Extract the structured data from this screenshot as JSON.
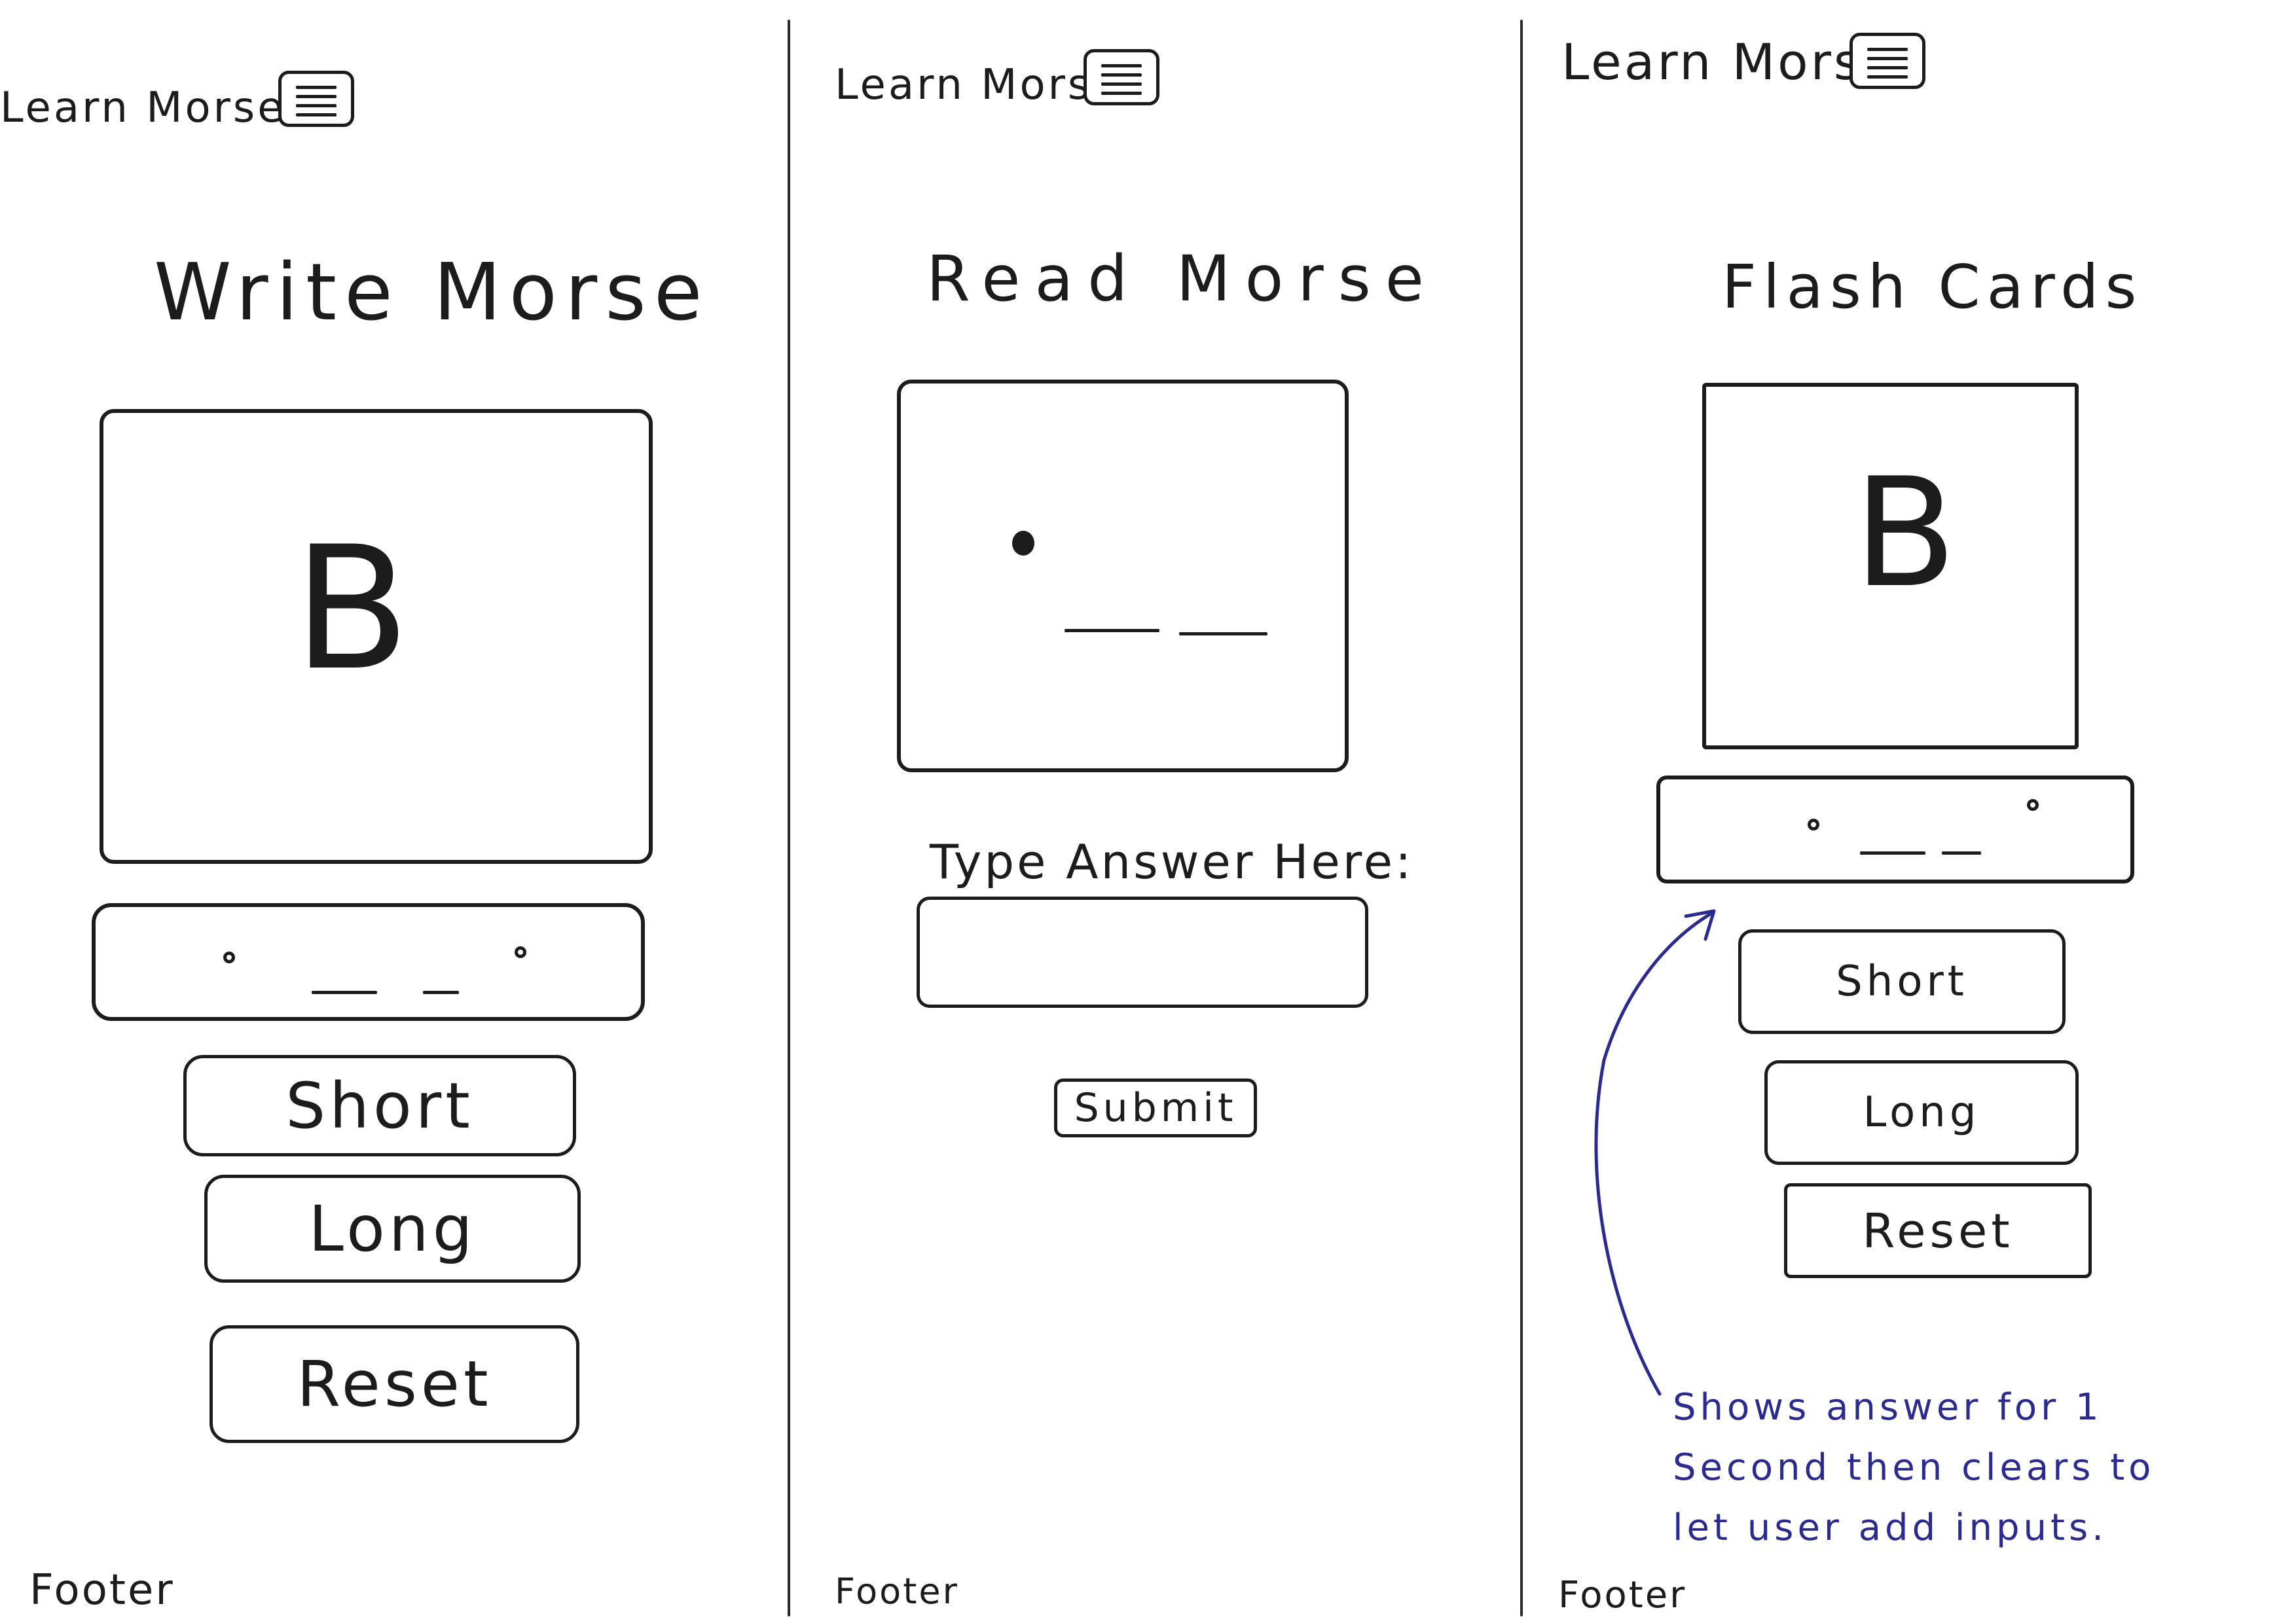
{
  "app": {
    "title": "Learn Morse",
    "menu_icon": "hamburger-menu-icon"
  },
  "screens": {
    "write": {
      "app_title": "Learn Morse",
      "page_title": "Write Morse",
      "letter": "B",
      "buttons": {
        "short": "Short",
        "long": "Long",
        "reset": "Reset"
      },
      "footer": "Footer"
    },
    "read": {
      "app_title": "Learn Morse",
      "page_title": "Read Morse",
      "answer_label": "Type Answer Here:",
      "answer_value": "",
      "submit": "Submit",
      "footer": "Footer"
    },
    "flash": {
      "app_title": "Learn Morse",
      "page_title": "Flash Cards",
      "letter": "B",
      "buttons": {
        "short": "Short",
        "long": "Long",
        "reset": "Reset"
      },
      "note": "Shows answer for 1 Second then clears to let user add inputs.",
      "footer": "Footer"
    }
  },
  "colors": {
    "ink": "#1c1c1c",
    "note_ink": "#2b2b8f"
  }
}
